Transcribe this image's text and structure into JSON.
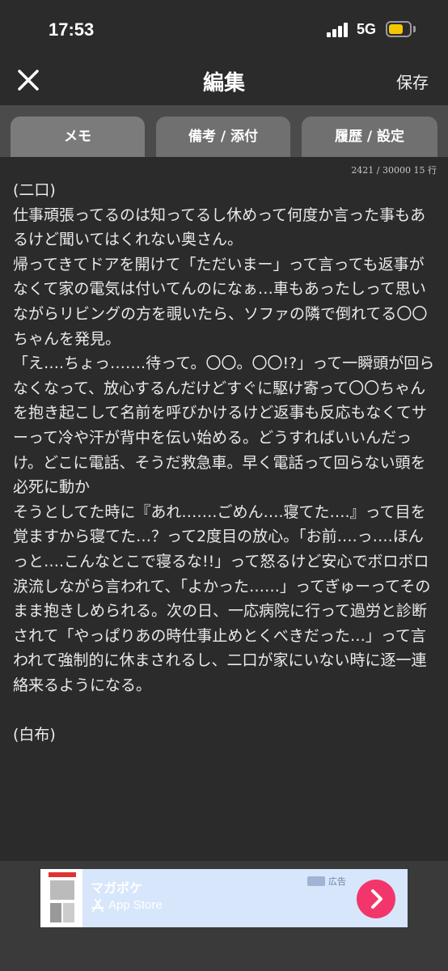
{
  "status_bar": {
    "time": "17:53",
    "network": "5G"
  },
  "header": {
    "title": "編集",
    "save_label": "保存"
  },
  "tabs": [
    {
      "label": "メモ"
    },
    {
      "label": "備考 / 添付"
    },
    {
      "label": "履歴 / 設定"
    }
  ],
  "editor": {
    "counter": "2421 / 30000  15 行",
    "text": "(二口)\n仕事頑張ってるのは知ってるし休めって何度か言った事もあるけど聞いてはくれない奥さん。\n帰ってきてドアを開けて「ただいまー」って言っても返事がなくて家の電気は付いてんのになぁ…車もあったしって思いながらリビングの方を覗いたら、ソファの隣で倒れてる〇〇ちゃんを発見。\n「え….ちょっ…….待って。〇〇。〇〇!?」って一瞬頭が回らなくなって、放心するんだけどすぐに駆け寄って〇〇ちゃんを抱き起こして名前を呼びかけるけど返事も反応もなくてサーって冷や汗が背中を伝い始める。どうすればいいんだっけ。どこに電話、そうだ救急車。早く電話って回らない頭を必死に動か\nそうとしてた時に『あれ…….ごめん….寝てた….』って目を覚ますから寝てた…？って2度目の放心。「お前….っ….ほんっと….こんなとこで寝るな!!」って怒るけど安心でボロボロ涙流しながら言われて、「よかった……」ってぎゅーってそのまま抱きしめられる。次の日、一応病院に行って過労と診断されて「やっぱりあの時仕事止めとくべきだった…」って言われて強制的に休まされるし、二口が家にいない時に逐一連絡来るようになる。\n\n(白布)"
  },
  "ad": {
    "app_name": "マガポケ",
    "store": "App Store",
    "badge": "広告",
    "colors": {
      "background": "#d7e6fb",
      "button": "#f2366c"
    }
  },
  "icons": [
    "close-icon",
    "chevron-right-icon",
    "app-store-icon",
    "signal-icon",
    "battery-icon"
  ],
  "colors": {
    "background": "#2b2b2b",
    "tabbar": "#4b4b4b",
    "tab": "#707070",
    "battery": "#f4c800"
  }
}
